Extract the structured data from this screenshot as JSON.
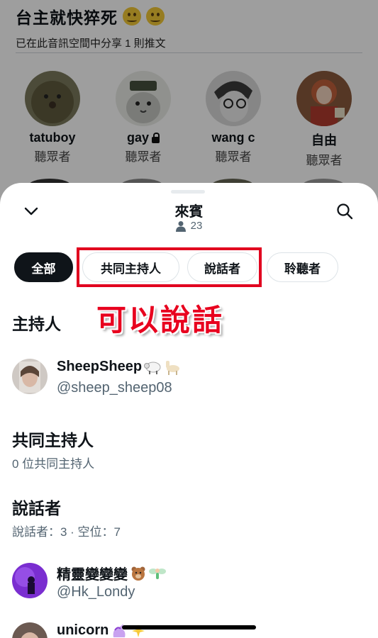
{
  "space": {
    "title": "台主就快猝死",
    "title_emojis": [
      "face-icon",
      "face-icon"
    ],
    "subtitle": "已在此音訊空間中分享 1 則推文",
    "listeners": [
      {
        "name": "tatuboy",
        "role": "聽眾者",
        "avatar": "hedgehog-avatar",
        "locked": false
      },
      {
        "name": "gay",
        "role": "聽眾者",
        "avatar": "cat-avatar",
        "locked": true
      },
      {
        "name": "wang c",
        "role": "聽眾者",
        "avatar": "sketch-avatar",
        "locked": false
      },
      {
        "name": "自由",
        "role": "聽眾者",
        "avatar": "painting-avatar",
        "locked": false
      }
    ]
  },
  "sheet": {
    "title": "來賓",
    "count": "23",
    "back_icon": "chevron-down-icon",
    "search_icon": "search-icon",
    "person_icon": "person-icon"
  },
  "tabs": [
    {
      "label": "全部",
      "active": true
    },
    {
      "label": "共同主持人",
      "active": false
    },
    {
      "label": "說話者",
      "active": false
    },
    {
      "label": "聆聽者",
      "active": false
    }
  ],
  "annotation": {
    "text": "可以說話",
    "color": "#e8001e"
  },
  "host_section": {
    "title": "主持人",
    "user": {
      "name": "SheepSheep",
      "handle": "@sheep_sheep08",
      "emojis": [
        "sheep-icon",
        "llama-icon"
      ]
    }
  },
  "cohost_section": {
    "title": "共同主持人",
    "subtitle": "0 位共同主持人"
  },
  "speaker_section": {
    "title": "說話者",
    "subtitle": "說話者：3 · 空位：7",
    "users": [
      {
        "name": "精靈變變變",
        "handle": "@Hk_Londy",
        "emojis": [
          "bear-icon",
          "fairy-icon"
        ]
      },
      {
        "name": "unicorn",
        "handle": "",
        "emojis": [
          "unicorn-icon",
          "sparkles-icon"
        ]
      }
    ]
  },
  "colors": {
    "text": "#0f1419",
    "secondary": "#536471",
    "highlight": "#e1001f"
  }
}
